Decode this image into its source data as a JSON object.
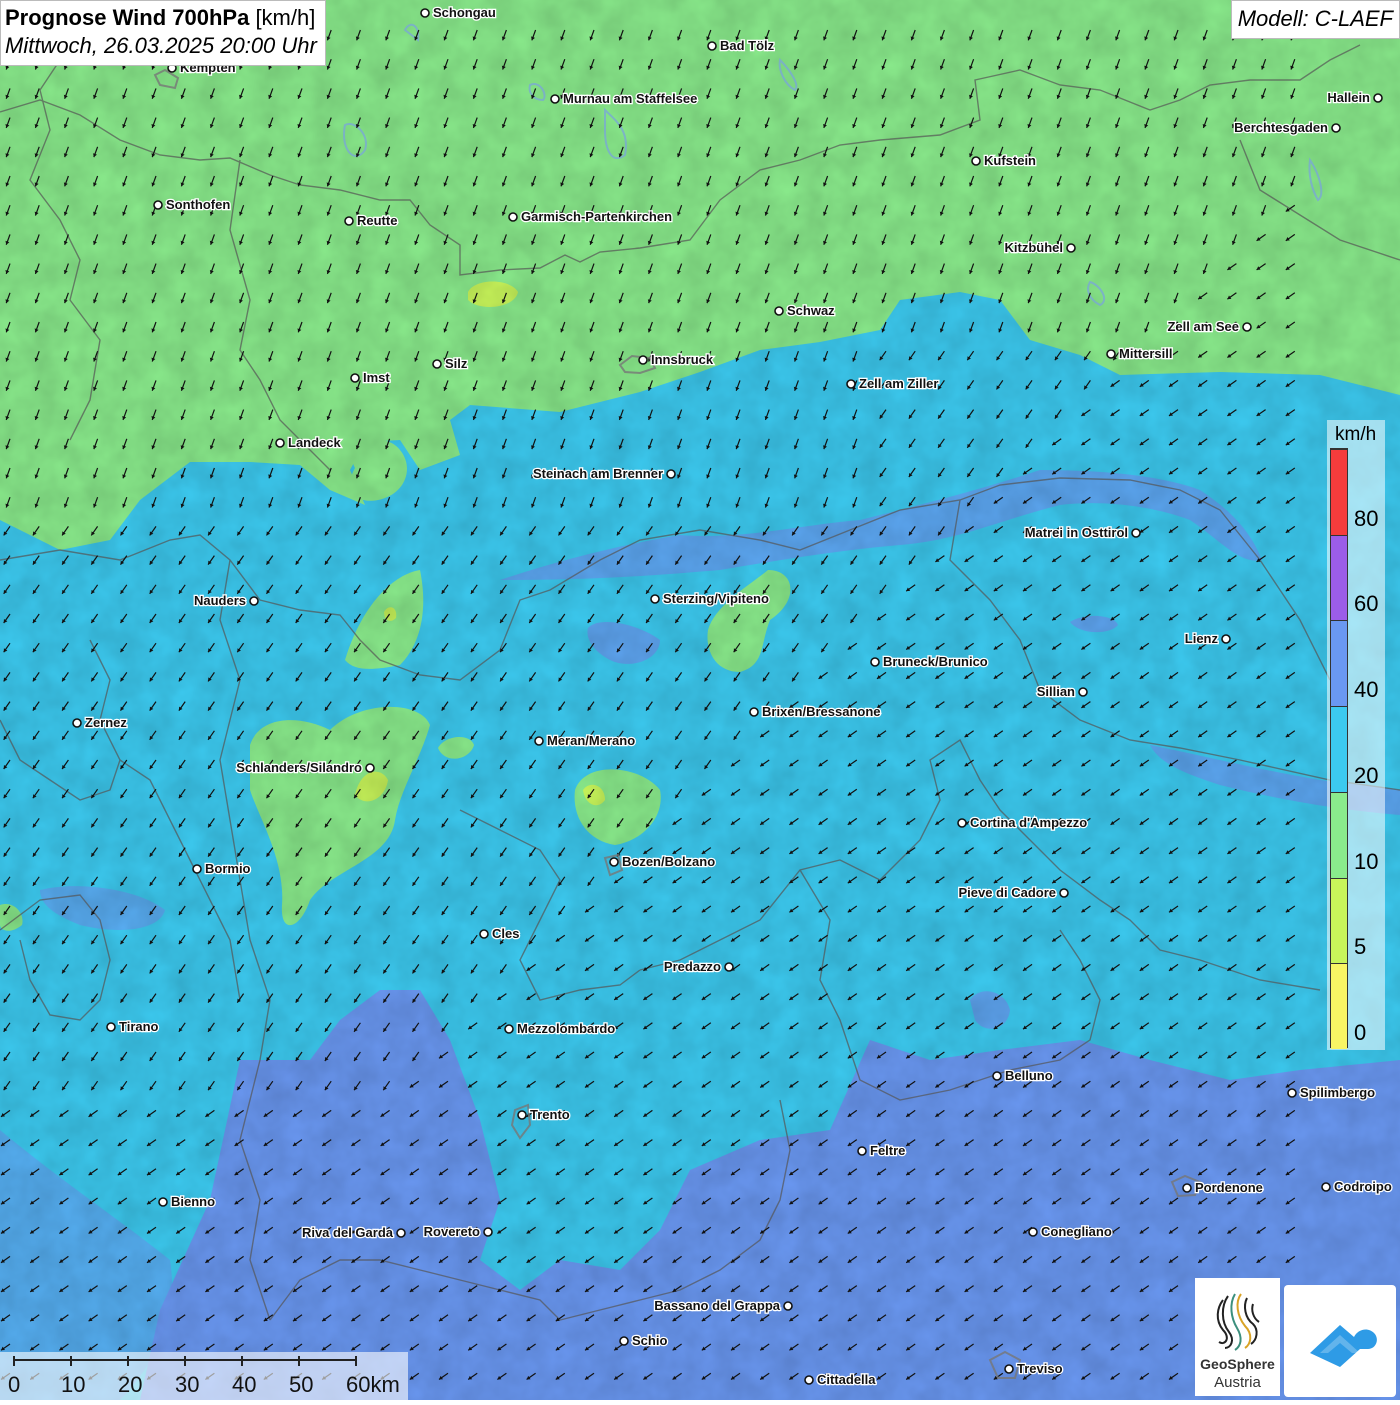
{
  "title": {
    "main": "Prognose Wind 700hPa",
    "unit": "[km/h]",
    "datetime": "Mittwoch, 26.03.2025 20:00 Uhr"
  },
  "model": "Modell: C-LAEF",
  "legend": {
    "unit": "km/h",
    "labels": [
      "80",
      "60",
      "40",
      "20",
      "10",
      "5",
      "0"
    ],
    "colors": [
      "#f53c3c",
      "#9b5de8",
      "#6a98f2",
      "#3ccaf0",
      "#8aeb8c",
      "#c8f55a",
      "#f8f564"
    ]
  },
  "scale": {
    "ticks": [
      "0",
      "10",
      "20",
      "30",
      "40",
      "50",
      "60km"
    ]
  },
  "logo": {
    "line1": "GeoSphere",
    "line2": "Austria"
  },
  "cities": [
    {
      "name": "Schongau",
      "label_side": "right"
    },
    {
      "name": "Bad Tölz",
      "label_side": "right"
    },
    {
      "name": "Kempten",
      "label_side": "right"
    },
    {
      "name": "Murnau am Staffelsee",
      "label_side": "right"
    },
    {
      "name": "Hallein",
      "label_side": "left"
    },
    {
      "name": "Berchtesgaden",
      "label_side": "left"
    },
    {
      "name": "Kufstein",
      "label_side": "right"
    },
    {
      "name": "Sonthofen",
      "label_side": "right"
    },
    {
      "name": "Reutte",
      "label_side": "right"
    },
    {
      "name": "Garmisch-Partenkirchen",
      "label_side": "right"
    },
    {
      "name": "Kitzbühel",
      "label_side": "left"
    },
    {
      "name": "Schwaz",
      "label_side": "right"
    },
    {
      "name": "Zell am See",
      "label_side": "left"
    },
    {
      "name": "Mittersill",
      "label_side": "right"
    },
    {
      "name": "Innsbruck",
      "label_side": "right"
    },
    {
      "name": "Silz",
      "label_side": "right"
    },
    {
      "name": "Imst",
      "label_side": "right"
    },
    {
      "name": "Zell am Ziller",
      "label_side": "right"
    },
    {
      "name": "Landeck",
      "label_side": "right"
    },
    {
      "name": "Steinach am Brenner",
      "label_side": "left"
    },
    {
      "name": "Matrei in Osttirol",
      "label_side": "left"
    },
    {
      "name": "Nauders",
      "label_side": "left"
    },
    {
      "name": "Sterzing/Vipiteno",
      "label_side": "right"
    },
    {
      "name": "Lienz",
      "label_side": "left"
    },
    {
      "name": "Bruneck/Brunico",
      "label_side": "right"
    },
    {
      "name": "Sillian",
      "label_side": "left"
    },
    {
      "name": "Zernez",
      "label_side": "right"
    },
    {
      "name": "Brixen/Bressanone",
      "label_side": "right"
    },
    {
      "name": "Meran/Merano",
      "label_side": "right"
    },
    {
      "name": "Schlanders/Silandro",
      "label_side": "left"
    },
    {
      "name": "Cortina d'Ampezzo",
      "label_side": "right"
    },
    {
      "name": "Bozen/Bolzano",
      "label_side": "right"
    },
    {
      "name": "Bormio",
      "label_side": "right"
    },
    {
      "name": "Pieve di Cadore",
      "label_side": "left"
    },
    {
      "name": "Cles",
      "label_side": "right"
    },
    {
      "name": "Predazzo",
      "label_side": "left"
    },
    {
      "name": "Tirano",
      "label_side": "right"
    },
    {
      "name": "Mezzolombardo",
      "label_side": "right"
    },
    {
      "name": "Belluno",
      "label_side": "right"
    },
    {
      "name": "Spilimbergo",
      "label_side": "right"
    },
    {
      "name": "Trento",
      "label_side": "right"
    },
    {
      "name": "Feltre",
      "label_side": "right"
    },
    {
      "name": "Pordenone",
      "label_side": "right"
    },
    {
      "name": "Codroipo",
      "label_side": "right"
    },
    {
      "name": "Bienno",
      "label_side": "right"
    },
    {
      "name": "Riva del Garda",
      "label_side": "left"
    },
    {
      "name": "Rovereto",
      "label_side": "left"
    },
    {
      "name": "Conegliano",
      "label_side": "right"
    },
    {
      "name": "Bassano del Grappa",
      "label_side": "left"
    },
    {
      "name": "Schio",
      "label_side": "right"
    },
    {
      "name": "Treviso",
      "label_side": "right"
    },
    {
      "name": "Cittadella",
      "label_side": "right"
    }
  ]
}
